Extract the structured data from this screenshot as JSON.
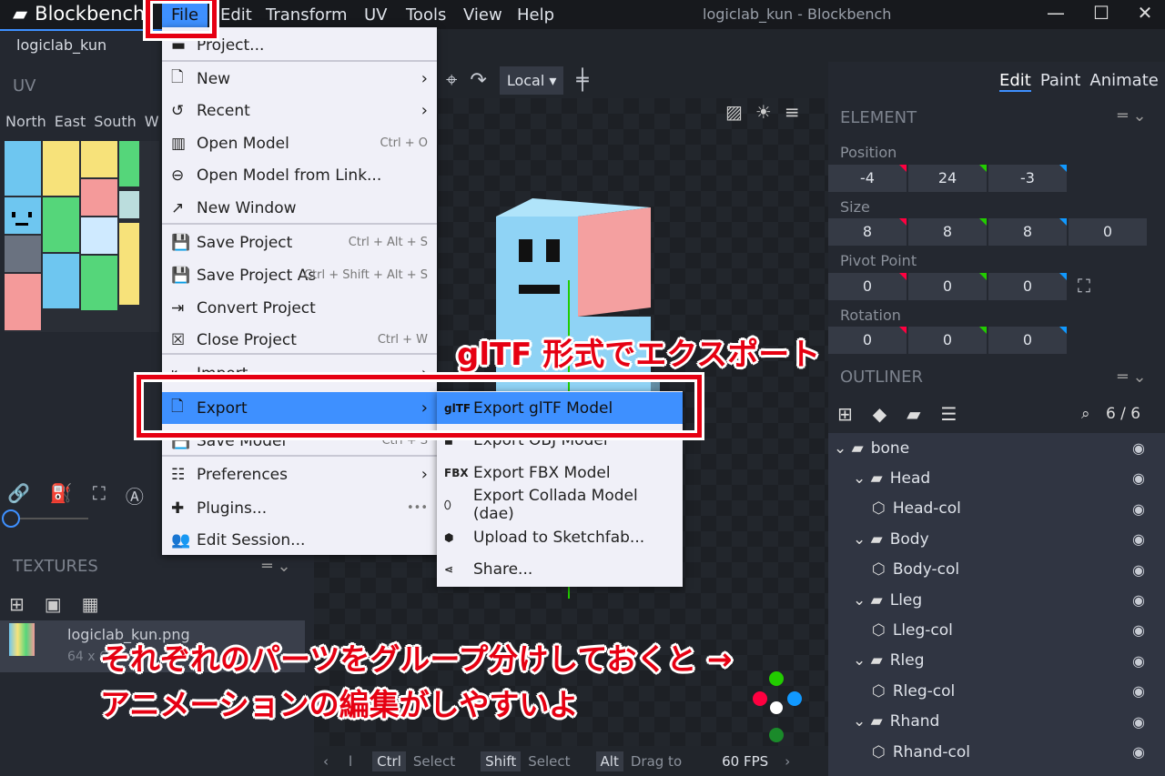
{
  "app": {
    "name": "Blockbench",
    "window_title": "logiclab_kun - Blockbench",
    "tab": "logiclab_kun"
  },
  "menubar": [
    "File",
    "Edit",
    "Transform",
    "UV",
    "Tools",
    "View",
    "Help"
  ],
  "window_controls": {
    "minimize": "—",
    "maximize": "☐",
    "close": "✕"
  },
  "uv_panel": {
    "title": "UV",
    "faces": [
      "North",
      "East",
      "South",
      "W"
    ]
  },
  "textures": {
    "title": "TEXTURES",
    "item_name": "logiclab_kun.png",
    "item_size": "64 x 64"
  },
  "viewport": {
    "space": "Local",
    "fps": "60 FPS",
    "status": [
      {
        "key": "Ctrl",
        "action": "Select"
      },
      {
        "key": "Shift",
        "action": "Select"
      },
      {
        "key": "Alt",
        "action": "Drag to"
      }
    ],
    "status_prefix": "l"
  },
  "modes": [
    "Edit",
    "Paint",
    "Animate"
  ],
  "element": {
    "title": "ELEMENT",
    "position_label": "Position",
    "position": [
      "-4",
      "24",
      "-3"
    ],
    "size_label": "Size",
    "size": [
      "8",
      "8",
      "8",
      "0"
    ],
    "pivot_label": "Pivot Point",
    "pivot": [
      "0",
      "0",
      "0"
    ],
    "rotation_label": "Rotation",
    "rotation": [
      "0",
      "0",
      "0"
    ]
  },
  "outliner": {
    "title": "OUTLINER",
    "count": "6 / 6",
    "items": [
      {
        "name": "bone",
        "type": "group",
        "depth": 0
      },
      {
        "name": "Head",
        "type": "group",
        "depth": 1
      },
      {
        "name": "Head-col",
        "type": "cube",
        "depth": 2
      },
      {
        "name": "Body",
        "type": "group",
        "depth": 1
      },
      {
        "name": "Body-col",
        "type": "cube",
        "depth": 2
      },
      {
        "name": "Lleg",
        "type": "group",
        "depth": 1
      },
      {
        "name": "Lleg-col",
        "type": "cube",
        "depth": 2
      },
      {
        "name": "Rleg",
        "type": "group",
        "depth": 1
      },
      {
        "name": "Rleg-col",
        "type": "cube",
        "depth": 2
      },
      {
        "name": "Rhand",
        "type": "group",
        "depth": 1
      },
      {
        "name": "Rhand-col",
        "type": "cube",
        "depth": 2
      }
    ]
  },
  "file_menu": [
    {
      "label": "Project...",
      "shortcut": ""
    },
    {
      "label": "New",
      "submenu": true
    },
    {
      "label": "Recent",
      "submenu": true
    },
    {
      "label": "Open Model",
      "shortcut": "Ctrl + O"
    },
    {
      "label": "Open Model from Link...",
      "shortcut": ""
    },
    {
      "label": "New Window",
      "shortcut": ""
    },
    {
      "label": "Save Project",
      "shortcut": "Ctrl + Alt + S"
    },
    {
      "label": "Save Project As",
      "shortcut": "Ctrl + Shift + Alt + S"
    },
    {
      "label": "Convert Project",
      "shortcut": ""
    },
    {
      "label": "Close Project",
      "shortcut": "Ctrl + W"
    },
    {
      "label": "Import",
      "submenu": true
    },
    {
      "label": "Export",
      "submenu": true
    },
    {
      "label": "Save Model",
      "shortcut": "Ctrl + S"
    },
    {
      "label": "Preferences",
      "submenu": true
    },
    {
      "label": "Plugins...",
      "shortcut": "•••"
    },
    {
      "label": "Edit Session...",
      "shortcut": ""
    }
  ],
  "export_menu": [
    {
      "label": "Export glTF Model",
      "icon": "glTF"
    },
    {
      "label": "Export OBJ Model",
      "icon": ""
    },
    {
      "label": "Export FBX Model",
      "icon": "FBX"
    },
    {
      "label": "Export Collada Model (dae)",
      "icon": ""
    },
    {
      "label": "Upload to Sketchfab...",
      "icon": ""
    },
    {
      "label": "Share...",
      "icon": ""
    }
  ],
  "annotations": {
    "callout": "glTF 形式でエクスポート",
    "note_line1": "それぞれのパーツをグループ分けしておくと →",
    "note_line2": "アニメーションの編集がしやすいよ"
  },
  "colors": {
    "accent": "#3e90ff",
    "annotation": "#e60012",
    "x": "#ff0040",
    "y": "#22cc00",
    "z": "#1199ff"
  }
}
